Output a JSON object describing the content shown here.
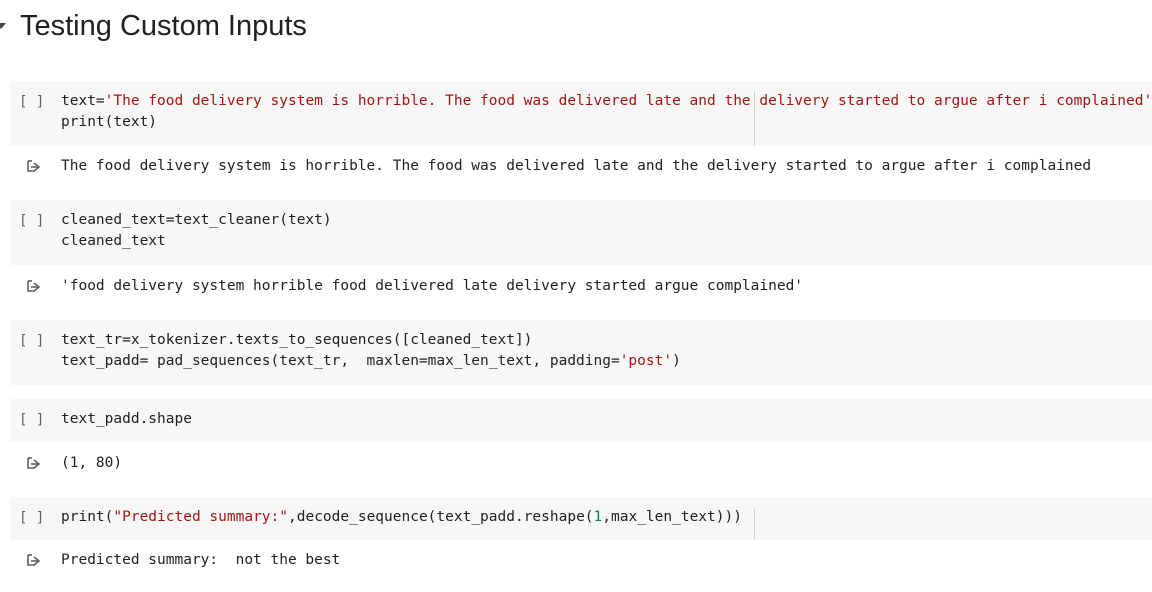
{
  "section": {
    "title": "Testing Custom Inputs"
  },
  "cells": [
    {
      "run_label": "[ ]",
      "code": [
        [
          "text=",
          "'The food delivery system is horrible. The food was delivered late and the delivery started to argue after i complained'"
        ],
        [
          "print(text)"
        ]
      ],
      "output": "The food delivery system is horrible. The food was delivered late and the delivery started to argue after i complained"
    },
    {
      "run_label": "[ ]",
      "code": [
        [
          "cleaned_text=text_cleaner(text)"
        ],
        [
          "cleaned_text"
        ]
      ],
      "output": "'food delivery system horrible food delivered late delivery started argue complained'"
    },
    {
      "run_label": "[ ]",
      "code": [
        [
          "text_tr=x_tokenizer.texts_to_sequences([cleaned_text])"
        ],
        [
          "text_padd= pad_sequences(text_tr,  maxlen=max_len_text, padding=",
          "'post'",
          ")"
        ]
      ]
    },
    {
      "run_label": "[ ]",
      "code": [
        [
          "text_padd.shape"
        ]
      ],
      "output": "(1, 80)"
    },
    {
      "run_label": "[ ]",
      "code": [
        [
          "print(",
          "\"Predicted summary:\"",
          ",decode_sequence(text_padd.reshape(",
          "1",
          ",max_len_text)))"
        ]
      ],
      "output": "Predicted summary:  not the best"
    }
  ]
}
